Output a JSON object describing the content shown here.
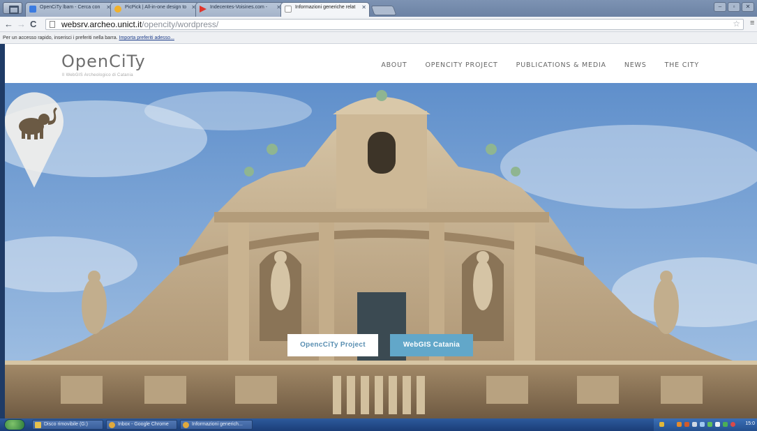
{
  "browser": {
    "tabs": [
      {
        "label": "OpenCiTy lbam - Cerca con",
        "favicon_color": "#3b7be0",
        "active": false
      },
      {
        "label": "PicPick | All-in-one design to",
        "favicon_color": "#f2b12b",
        "active": false
      },
      {
        "label": "Indecentes-Voisines.com - ",
        "favicon_color": "#e0342b",
        "active": false
      },
      {
        "label": "Informazioni generiche relat",
        "favicon_color": "#ffffff",
        "active": true
      }
    ],
    "url_host": "websrv.archeo.unict.it",
    "url_path": "/opencity/wordpress/",
    "bookmark_bar_text": "Per un accesso rapido, inserisci i preferiti nella barra.",
    "bookmark_bar_link": "Importa preferiti adesso..."
  },
  "site": {
    "logo": "OpenCiTy",
    "tagline": "Il WebGIS Archeologico di Catania",
    "nav": [
      "ABOUT",
      "OPENCITY PROJECT",
      "PUBLICATIONS & MEDIA",
      "NEWS",
      "THE CITY"
    ],
    "buttons": {
      "project": "OpencCiTy Project",
      "webgis": "WebGIS Catania"
    }
  },
  "taskbar": {
    "items": [
      "Disco rimovibile (G:)",
      "Inbox - Google Chrome",
      "Informazioni generich..."
    ],
    "clock": "15:0"
  },
  "colors": {
    "accent": "#62a7c9",
    "sky": "#6f9bd0",
    "stone": "#c9b596"
  }
}
